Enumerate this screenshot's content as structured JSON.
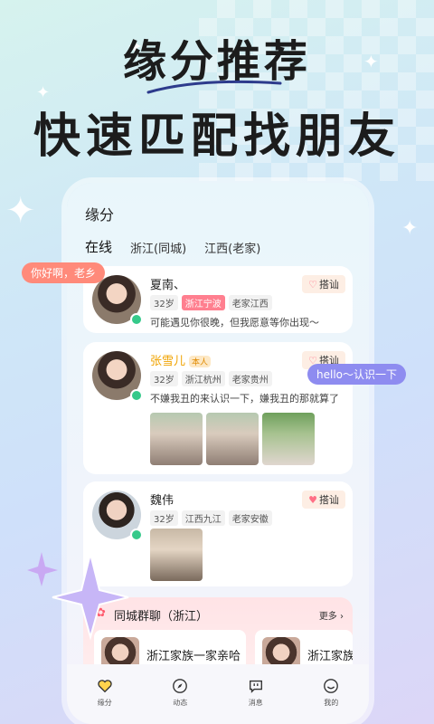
{
  "headline": {
    "line1": "缘分推荐",
    "line2": "快速匹配找朋友"
  },
  "app": {
    "title": "缘分"
  },
  "tabs": [
    "在线",
    "浙江(同城)",
    "江西(老家)"
  ],
  "bubbles": {
    "left": "你好啊，老乡",
    "right": "hello～认识一下"
  },
  "greet_label": "搭讪",
  "self_badge": "本人",
  "users": [
    {
      "name": "夏南、",
      "age": "32岁",
      "location": "浙江宁波",
      "hometown": "老家江西",
      "bio": "可能遇见你很晚，但我愿意等你出现～"
    },
    {
      "name": "张雪儿",
      "age": "32岁",
      "location": "浙江杭州",
      "hometown": "老家贵州",
      "bio": "不嫌我丑的来认识一下，嫌我丑的那就算了"
    },
    {
      "name": "魏伟",
      "age": "32岁",
      "location": "江西九江",
      "hometown": "老家安徽"
    }
  ],
  "group": {
    "title": "同城群聊（浙江）",
    "more": "更多",
    "items": [
      "浙江家族一家亲哈",
      "浙江家族"
    ]
  },
  "nav": [
    "缘分",
    "动态",
    "消息",
    "我的"
  ],
  "colors": {
    "accent_pink": "#ff7f8f",
    "online": "#35c98a",
    "vip_name": "#f0a300"
  }
}
